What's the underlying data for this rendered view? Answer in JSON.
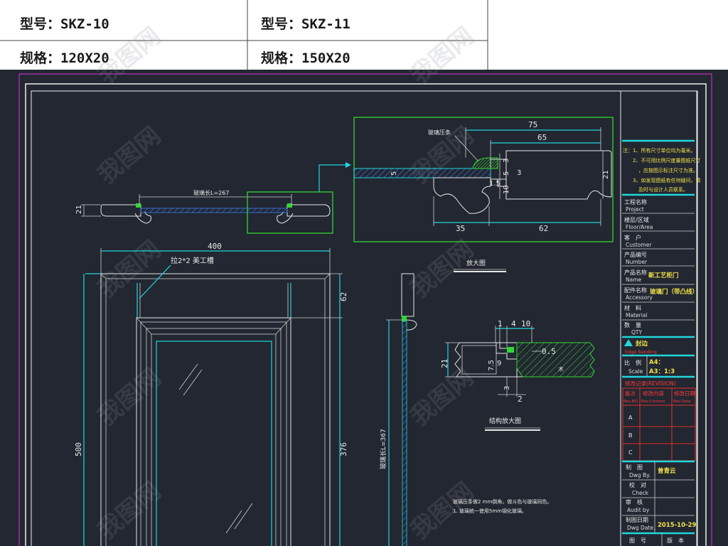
{
  "header": {
    "model_1": "型号：SKZ-10",
    "model_2": "型号：SKZ-11",
    "spec_1": "规格：120X20",
    "spec_2": "规格：150X20"
  },
  "drawing": {
    "section_top": {
      "dim_21": "21",
      "glass_length": "玻璃长L=267"
    },
    "detail_top": {
      "label": "玻璃压条",
      "d75": "75",
      "d65": "65",
      "d3a": "3",
      "d5a": "5",
      "d3b": "3",
      "d21": "21",
      "d15": "1.5",
      "d10": "10",
      "d5b": "5",
      "d35": "35",
      "d62": "62"
    },
    "elevation": {
      "width": "400",
      "height": "500",
      "top_rail": "62",
      "glass_height": "376",
      "groove_note": "拉2*2 美工槽"
    },
    "side_section": {
      "glass_length": "玻璃长L=367"
    },
    "enlarged_title": "放大图",
    "detail_right": {
      "d1": "1",
      "d4": "4",
      "d10": "10",
      "d05": "0.5",
      "d21": "21",
      "d75": "7.5",
      "d9": "9",
      "d3": "3",
      "d2": "2",
      "material": "木"
    },
    "detail_right_title": "结构放大图",
    "notes": [
      "玻璃压条做2 mm倒角，做斗色与玻璃同色。",
      "1. 玻璃统一使用5mm钢化玻璃。"
    ]
  },
  "title_block": {
    "notes": [
      "注：1、所有尺寸单位均为毫米。",
      "2、不可用比例尺度量图纸尺寸",
      "，应按图示标注尺寸为准。",
      "3、如发现图纸有任何疑问，请",
      "及时与设计人员联系。"
    ],
    "fields": [
      {
        "cn": "工程名称",
        "en": "Project",
        "value": ""
      },
      {
        "cn": "楼层/区域",
        "en": "Floor/Area",
        "value": ""
      },
      {
        "cn": "客　户",
        "en": "Customer",
        "value": ""
      },
      {
        "cn": "产品编号",
        "en": "Number",
        "value": ""
      },
      {
        "cn": "产品名称",
        "en": "Name",
        "value": "新工艺柜门"
      },
      {
        "cn": "配件名称",
        "en": "Accessory",
        "value": "玻璃门（带凸线）"
      },
      {
        "cn": "材　料",
        "en": "Material",
        "value": ""
      },
      {
        "cn": "数　量",
        "en": "QTY",
        "value": ""
      }
    ],
    "edge": {
      "cn": "封边",
      "en": "Edge banding"
    },
    "scale": {
      "cn": "比　例",
      "en": "Scale",
      "a4": "A4：",
      "a3": "A3：1:3"
    },
    "revision": {
      "title": "修改记录(REVISION)",
      "headers_cn": [
        "版次",
        "修改内容",
        "修改日期"
      ],
      "headers_en": [
        "Rev.NO",
        "Rev.Content",
        "Rev.Date"
      ],
      "rows": [
        "A",
        "B",
        "C"
      ]
    },
    "sign": [
      {
        "cn": "制　图",
        "en": "Dwg By.",
        "value": "曾青云"
      },
      {
        "cn": "校　对",
        "en": "Check",
        "value": ""
      },
      {
        "cn": "审　核",
        "en": "Audit by",
        "value": ""
      },
      {
        "cn": "制图日期",
        "en": "Dwg Date.",
        "value": "2015-10-29"
      }
    ],
    "bottom": {
      "drawing_no": "图　号",
      "version": "版　本"
    }
  },
  "watermark": "我图网",
  "colors": {
    "background": "#222731",
    "cyan": "#22d6dc",
    "green": "#33d633",
    "yellow": "#f2e24a",
    "red": "#e03030",
    "magenta": "#c030c0",
    "glass_blue": "#3d7df5"
  }
}
